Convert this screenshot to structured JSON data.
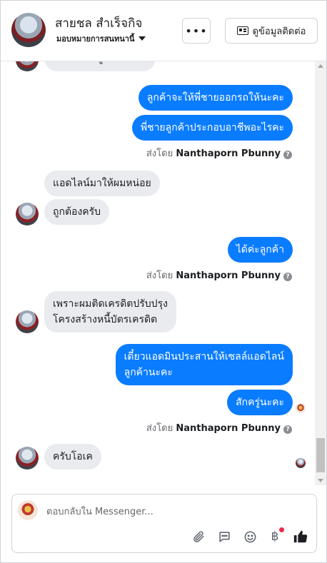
{
  "header": {
    "name": "สายชล สำเร็จกิจ",
    "subtitle": "มอบหมายการสนทนานี้",
    "more_label": "•••",
    "contact_label": "ดูข้อมูลติดต่อ"
  },
  "conversation": {
    "partial_top_text": "หอดผมมาดูคายขอดด",
    "messages": [
      {
        "side": "out",
        "text": "ลูกค้าจะให้พี่ชายออกรถให้นะคะ"
      },
      {
        "side": "out",
        "text": "พี่ชายลูกค้าประกอบอาชีพอะไรคะ"
      },
      {
        "side": "meta",
        "sent_by_prefix": "ส่งโดย",
        "sent_by_name": "Nanthaporn Pbunny"
      },
      {
        "side": "in",
        "text": "แอดไลน์มาให้ผมหน่อย"
      },
      {
        "side": "in",
        "text": "ถูกต้องครับ"
      },
      {
        "side": "out",
        "text": "ได้ค่ะลูกค้า"
      },
      {
        "side": "meta",
        "sent_by_prefix": "ส่งโดย",
        "sent_by_name": "Nanthaporn Pbunny"
      },
      {
        "side": "in",
        "text_line1": "เพราะผมติดเครดิตปรับปรุง",
        "text_line2": "โครงสร้างหนี้บัตรเครดิต"
      },
      {
        "side": "out",
        "text_line1": "เดี๋ยวแอดมินประสานให้เซลล์แอดไลน์",
        "text_line2": "ลูกค้านะคะ"
      },
      {
        "side": "out",
        "text": "สักครู่นะคะ"
      },
      {
        "side": "meta",
        "sent_by_prefix": "ส่งโดย",
        "sent_by_name": "Nanthaporn Pbunny"
      },
      {
        "side": "in",
        "text": "ครับโอเค"
      }
    ]
  },
  "composer": {
    "placeholder": "ตอบกลับใน Messenger...",
    "tools": [
      "paperclip-icon",
      "chat-bubble-icon",
      "smiley-icon",
      "baht-icon",
      "thumbs-up-icon"
    ],
    "baht_symbol": "฿"
  },
  "colors": {
    "outgoing_bubble": "#0a7cff",
    "incoming_bubble": "#e9ebee",
    "like_icon": "#1c1e21",
    "notification_dot": "#f02849"
  }
}
